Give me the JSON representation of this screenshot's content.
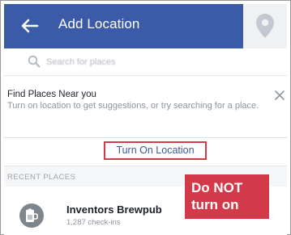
{
  "header": {
    "title": "Add Location",
    "back_icon": "back-arrow-icon",
    "pin_icon": "location-pin-icon",
    "bar_color": "#3b5aa8"
  },
  "search": {
    "placeholder": "Search for places",
    "icon": "search-icon"
  },
  "find_places": {
    "title": "Find Places Near you",
    "description": "Turn on location to get suggestions, or try searching for a place.",
    "close_icon": "close-icon"
  },
  "turn_on_location": {
    "label": "Turn On Location",
    "highlight_color": "#d23a4a"
  },
  "recent": {
    "header": "RECENT PLACES",
    "items": [
      {
        "name": "Inventors Brewpub",
        "subtitle": "1,287 check-ins",
        "icon": "beer-mug-icon"
      }
    ]
  },
  "annotation": {
    "line1": "Do NOT",
    "line2": "turn on",
    "color": "#d23a4a"
  }
}
